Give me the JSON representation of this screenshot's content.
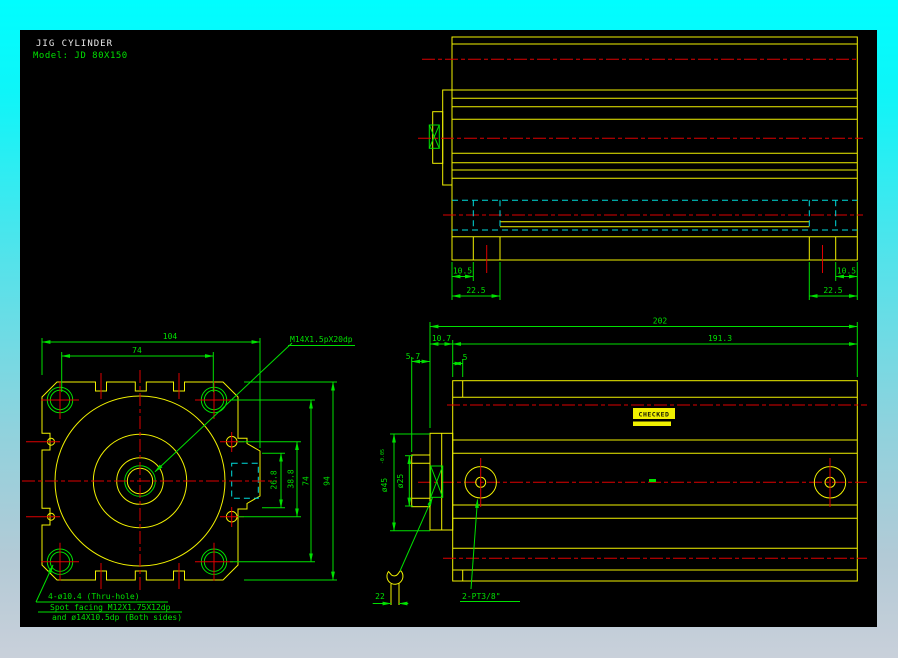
{
  "header": {
    "title": "JIG CYLINDER",
    "model": "Model: JD 80X150"
  },
  "colors": {
    "outline": "#f2f200",
    "dimension": "#00e000",
    "centerline": "#dd0000",
    "hidden_line": "#00dcdc",
    "title_text": "#e8e8e8",
    "stamp_bg": "#f0f000",
    "frame_top": "#00feff",
    "frame_bottom": "#c9d0da",
    "canvas_bg": "#000000"
  },
  "top_side_view": {
    "dim_left_inner": "10.5",
    "dim_left_outer": "22.5",
    "dim_right_inner": "10.5",
    "dim_right_outer": "22.5"
  },
  "front_view": {
    "dim_width_overall": "104",
    "dim_width_holes": "74",
    "dim_boss": "26.8",
    "dim_port_span": "38.8",
    "dim_holes_vert": "74",
    "dim_height": "94",
    "thread_label": "M14X1.5pX20dp",
    "note_line1": "4-ø10.4 (Thru-hole)",
    "note_line2": "Spot facing M12X1.75X12dp",
    "note_line3": "and ø14X10.5dp (Both sides)"
  },
  "side_view": {
    "dim_overall": "202",
    "dim_head": "10.7",
    "dim_body": "191.3",
    "dim_rod_ext": "5.7",
    "dim_port_offset": "5",
    "dim_bore": "ø45",
    "dim_bore_tol": "-0.05",
    "dim_rod": "ø25",
    "dim_wrench_flat": "22",
    "port_label": "2-PT3/8\"",
    "stamp_label": "CHECKED"
  }
}
